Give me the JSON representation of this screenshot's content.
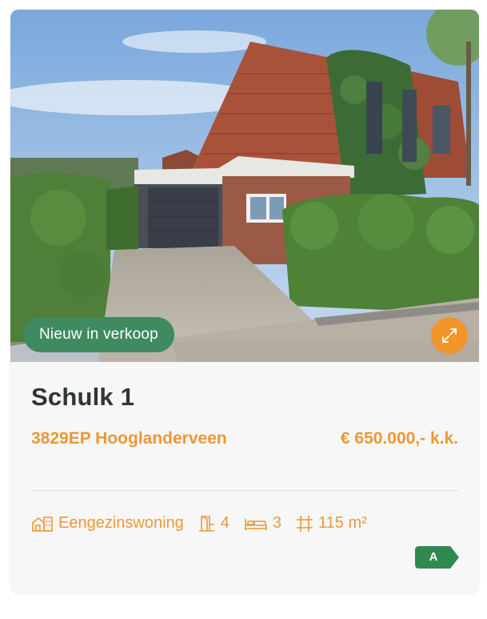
{
  "listing": {
    "status_badge": "Nieuw in verkoop",
    "title": "Schulk 1",
    "address": "3829EP Hooglanderveen",
    "price": "€ 650.000,- k.k.",
    "photo_alt": "",
    "expand_icon": "expand-arrows-icon",
    "features": {
      "type_label": "Eengezinswoning",
      "type_icon": "house-icon",
      "rooms": "4",
      "rooms_icon": "door-icon",
      "bedrooms": "3",
      "bedrooms_icon": "bed-icon",
      "area": "115 m²",
      "area_icon": "area-icon"
    },
    "energy_label": "A",
    "colors": {
      "accent": "#ec9834",
      "badge_green": "#3f8a5f",
      "energy_green": "#2e8a4f",
      "title": "#2f3437"
    }
  }
}
